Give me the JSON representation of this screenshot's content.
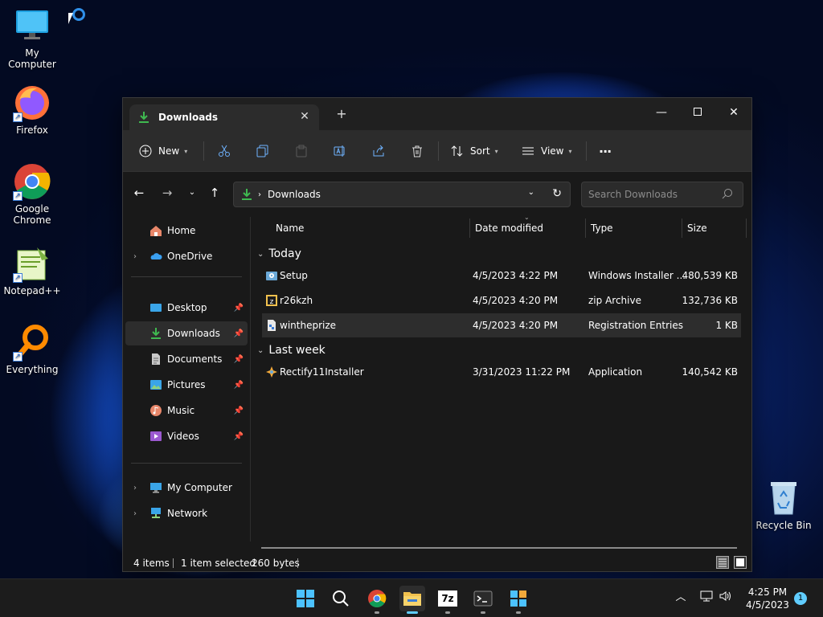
{
  "desktop": {
    "icons": [
      {
        "label": "My Computer",
        "icon": "monitor-icon"
      },
      {
        "label": "Firefox",
        "icon": "firefox-icon"
      },
      {
        "label": "Google Chrome",
        "icon": "chrome-icon"
      },
      {
        "label": "Notepad++",
        "icon": "notepadpp-icon"
      },
      {
        "label": "Everything",
        "icon": "everything-icon"
      },
      {
        "label": "Recycle Bin",
        "icon": "recycle-bin-icon"
      }
    ]
  },
  "explorer": {
    "tab_title": "Downloads",
    "toolbar": {
      "new_label": "New",
      "sort_label": "Sort",
      "view_label": "View",
      "more_label": "···"
    },
    "address": {
      "path": "Downloads",
      "search_placeholder": "Search Downloads"
    },
    "nav": {
      "items": [
        {
          "label": "Home"
        },
        {
          "label": "OneDrive"
        },
        {
          "label": "Desktop"
        },
        {
          "label": "Downloads"
        },
        {
          "label": "Documents"
        },
        {
          "label": "Pictures"
        },
        {
          "label": "Music"
        },
        {
          "label": "Videos"
        },
        {
          "label": "My Computer"
        },
        {
          "label": "Network"
        }
      ]
    },
    "columns": {
      "name": "Name",
      "date": "Date modified",
      "type": "Type",
      "size": "Size"
    },
    "groups": [
      {
        "label": "Today",
        "files": [
          {
            "name": "Setup",
            "date": "4/5/2023 4:22 PM",
            "type": "Windows Installer ...",
            "size": "480,539 KB",
            "icon": "installer-icon"
          },
          {
            "name": "r26kzh",
            "date": "4/5/2023 4:20 PM",
            "type": "zip Archive",
            "size": "132,736 KB",
            "icon": "zip-icon"
          },
          {
            "name": "wintheprize",
            "date": "4/5/2023 4:20 PM",
            "type": "Registration Entries",
            "size": "1 KB",
            "icon": "registry-icon"
          }
        ]
      },
      {
        "label": "Last week",
        "files": [
          {
            "name": "Rectify11Installer",
            "date": "3/31/2023 11:22 PM",
            "type": "Application",
            "size": "140,542 KB",
            "icon": "app-icon"
          }
        ]
      }
    ],
    "status": {
      "items": "4 items",
      "selected": "1 item selected",
      "size": "260 bytes"
    }
  },
  "taskbar": {
    "time": "4:25 PM",
    "date": "4/5/2023",
    "notification_count": "1",
    "sevenzip_label": "7z"
  },
  "colors": {
    "accent": "#60cdff",
    "folder_green": "#3fb950",
    "window_bg": "#191919"
  }
}
